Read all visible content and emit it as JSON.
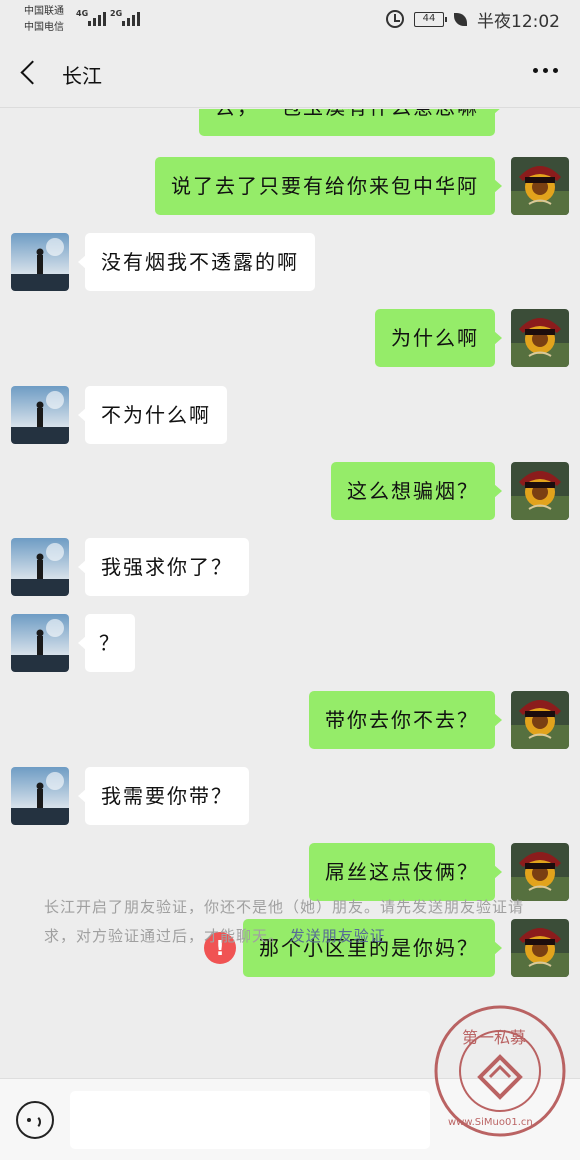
{
  "status_bar": {
    "carrier1": "中国联通",
    "carrier2": "中国电信",
    "net1": "4G",
    "net2": "2G",
    "battery": "44",
    "time": "半夜12:02",
    "icons": [
      "alarm-icon",
      "battery-icon",
      "leaf-icon"
    ]
  },
  "nav": {
    "title": "长江",
    "back_icon": "chevron-left-icon",
    "more_icon": "more-dots-icon"
  },
  "messages": [
    {
      "side": "right",
      "text": "去，一包玉溪有什么意思嘛"
    },
    {
      "side": "right",
      "text": "说了去了只要有给你来包中华阿"
    },
    {
      "side": "left",
      "text": "没有烟我不透露的啊"
    },
    {
      "side": "right",
      "text": "为什么啊"
    },
    {
      "side": "left",
      "text": "不为什么啊"
    },
    {
      "side": "right",
      "text": "这么想骗烟？"
    },
    {
      "side": "left",
      "text": "我强求你了？"
    },
    {
      "side": "left",
      "text": "？"
    },
    {
      "side": "right",
      "text": "带你去你不去？"
    },
    {
      "side": "left",
      "text": "我需要你带？"
    },
    {
      "side": "right",
      "text": "屌丝这点伎俩？"
    },
    {
      "side": "right",
      "text": "那个小区里的是你妈？",
      "status": "failed"
    }
  ],
  "error_mark": "!",
  "system_note": {
    "text": "长江开启了朋友验证，你还不是他（她）朋友。请先发送朋友验证请求，对方验证通过后，才能聊天。",
    "link": "发送朋友验证"
  },
  "input_bar": {
    "voice_icon": "voice-icon",
    "placeholder": ""
  },
  "watermark": {
    "top_text": "第一私募",
    "bottom_text": "www.SiMuo01.cn"
  },
  "colors": {
    "background": "#ededed",
    "outgoing_bubble": "#95ec69",
    "incoming_bubble": "#ffffff",
    "error": "#f05353",
    "link": "#576b95"
  }
}
